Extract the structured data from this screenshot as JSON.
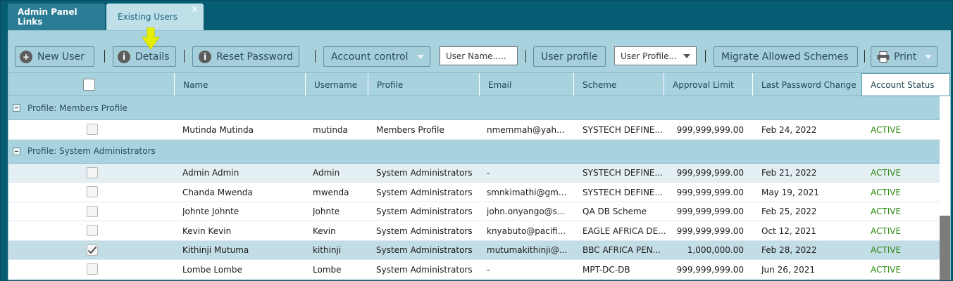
{
  "tabs": {
    "admin_label": "Admin Panel Links",
    "users_label": "Existing Users",
    "close_glyph": "×"
  },
  "toolbar": {
    "new_user": "New User",
    "details": "Details",
    "reset_password": "Reset Password",
    "account_control": "Account control",
    "username_placeholder": "User Name.....",
    "user_profile": "User profile",
    "profile_select": "User Profile...",
    "migrate": "Migrate Allowed Schemes",
    "print": "Print",
    "info_glyph": "i",
    "plus_glyph": "+"
  },
  "columns": [
    "Name",
    "Username",
    "Profile",
    "Email",
    "Scheme",
    "Approval Limit",
    "Last Password Change",
    "Account Status"
  ],
  "groups": [
    {
      "label": "Profile: Members Profile",
      "rows": [
        {
          "name": "Mutinda Mutinda",
          "username": "mutinda",
          "profile": "Members Profile",
          "email": "nmemmah@yah...",
          "scheme": "SYSTECH DEFINE...",
          "limit": "999,999,999.00",
          "last_change": "Feb 24, 2022",
          "status": "ACTIVE",
          "checked": false
        }
      ]
    },
    {
      "label": "Profile: System Administrators",
      "rows": [
        {
          "name": "Admin Admin",
          "username": "Admin",
          "profile": "System Administrators",
          "email": "-",
          "scheme": "SYSTECH DEFINE...",
          "limit": "999,999,999.00",
          "last_change": "Feb 21, 2022",
          "status": "ACTIVE",
          "checked": false
        },
        {
          "name": "Chanda Mwenda",
          "username": "mwenda",
          "profile": "System Administrators",
          "email": "smnkimathi@gm...",
          "scheme": "SYSTECH DEFINE...",
          "limit": "999,999,999.00",
          "last_change": "May 19, 2021",
          "status": "ACTIVE",
          "checked": false
        },
        {
          "name": "Johnte Johnte",
          "username": "Johnte",
          "profile": "System Administrators",
          "email": "john.onyango@s...",
          "scheme": "QA DB Scheme",
          "limit": "999,999,999.00",
          "last_change": "Feb 25, 2022",
          "status": "ACTIVE",
          "checked": false
        },
        {
          "name": "Kevin Kevin",
          "username": "Kevin",
          "profile": "System Administrators",
          "email": "knyabuto@pacifi...",
          "scheme": "EAGLE AFRICA DE...",
          "limit": "999,999,999.00",
          "last_change": "Oct 12, 2021",
          "status": "ACTIVE",
          "checked": false
        },
        {
          "name": "Kithinji Mutuma",
          "username": "kithinji",
          "profile": "System Administrators",
          "email": "mutumakithinji@...",
          "scheme": "BBC AFRICA PEN...",
          "limit": "1,000,000.00",
          "last_change": "Feb 28, 2022",
          "status": "ACTIVE",
          "checked": true
        },
        {
          "name": "Lombe Lombe",
          "username": "Lombe",
          "profile": "System Administrators",
          "email": "-",
          "scheme": "MPT-DC-DB",
          "limit": "999,999,999.00",
          "last_change": "Jun 26, 2021",
          "status": "ACTIVE",
          "checked": false
        }
      ]
    }
  ],
  "colors": {
    "frame": "#065c73",
    "tab_active": "#bfe0e9",
    "toolbar": "#a9d2df",
    "status_active": "#2c8a12",
    "pointer": "#e5f000"
  },
  "icons": {
    "new_user": "plus-circle-icon",
    "details": "info-circle-icon",
    "reset_password": "info-circle-icon",
    "print": "printer-icon",
    "pointer": "down-arrow-pointer-icon"
  }
}
